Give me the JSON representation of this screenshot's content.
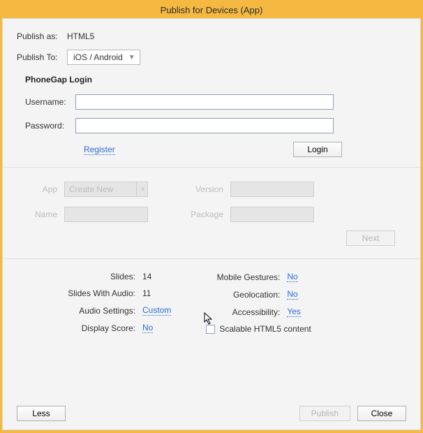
{
  "title": "Publish for Devices (App)",
  "publish_as": {
    "label": "Publish as:",
    "value": "HTML5"
  },
  "publish_to": {
    "label": "Publish To:",
    "value": "iOS / Android"
  },
  "phonegap": {
    "title": "PhoneGap Login",
    "username_label": "Username:",
    "password_label": "Password:",
    "username_value": "",
    "password_value": "",
    "register_link": "Register",
    "login_button": "Login"
  },
  "app_section": {
    "app_label": "App",
    "app_select_value": "Create New",
    "name_label": "Name",
    "version_label": "Version",
    "package_label": "Package",
    "next_button": "Next"
  },
  "info": {
    "slides_label": "Slides:",
    "slides_value": "14",
    "slides_audio_label": "Slides With Audio:",
    "slides_audio_value": "11",
    "audio_settings_label": "Audio Settings:",
    "audio_settings_value": "Custom",
    "display_score_label": "Display Score:",
    "display_score_value": "No",
    "mobile_gestures_label": "Mobile Gestures:",
    "mobile_gestures_value": "No",
    "geolocation_label": "Geolocation:",
    "geolocation_value": "No",
    "accessibility_label": "Accessibility:",
    "accessibility_value": "Yes",
    "scalable_label": "Scalable HTML5 content"
  },
  "footer": {
    "less": "Less",
    "publish": "Publish",
    "close": "Close"
  }
}
